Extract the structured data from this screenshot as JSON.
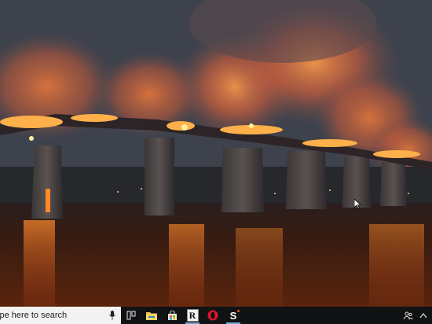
{
  "taskbar": {
    "search_placeholder": "ype here to search",
    "pinned_apps": [
      {
        "name": "task-view",
        "icon": "task-view-icon"
      },
      {
        "name": "file-explorer",
        "icon": "folder-icon"
      },
      {
        "name": "microsoft-store",
        "icon": "store-icon"
      },
      {
        "name": "r-app",
        "icon": "r-letter-icon",
        "label": "R"
      },
      {
        "name": "opera",
        "icon": "opera-icon"
      },
      {
        "name": "s-app",
        "icon": "s-letter-icon",
        "label": "S"
      }
    ]
  },
  "colors": {
    "taskbar": "#101214",
    "search_box": "#f2f2f2",
    "fire": "#ff7a1a",
    "water_reflection": "#c9501a"
  }
}
